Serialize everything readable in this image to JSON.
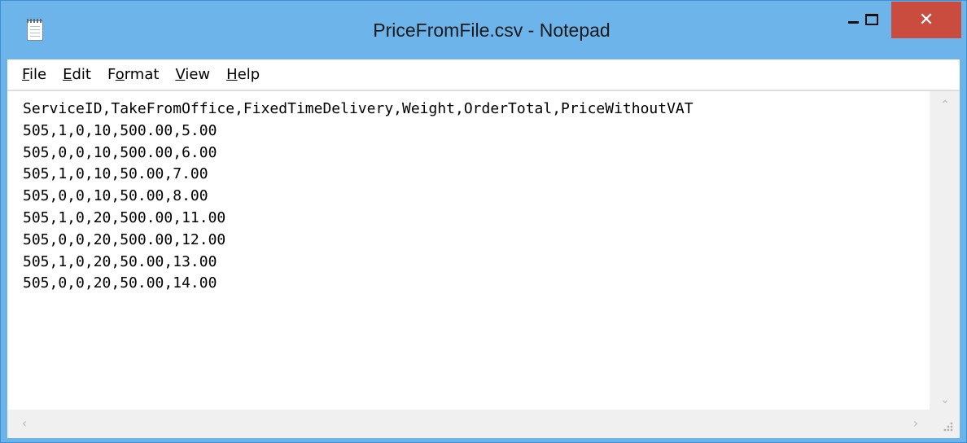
{
  "window": {
    "title": "PriceFromFile.csv - Notepad",
    "icon": "notepad-icon",
    "controls": {
      "minimize_icon": "minimize-icon",
      "maximize_icon": "maximize-icon",
      "close_glyph": "✕"
    },
    "colors": {
      "titlebar": "#6db4ea",
      "close_button": "#c94c3f"
    }
  },
  "menu": {
    "items": [
      {
        "accel": "F",
        "rest": "ile"
      },
      {
        "accel": "E",
        "rest": "dit"
      },
      {
        "pre": "F",
        "accel": "o",
        "rest": "rmat"
      },
      {
        "accel": "V",
        "rest": "iew"
      },
      {
        "accel": "H",
        "rest": "elp"
      }
    ]
  },
  "document": {
    "lines": [
      "ServiceID,TakeFromOffice,FixedTimeDelivery,Weight,OrderTotal,PriceWithoutVAT",
      "505,1,0,10,500.00,5.00",
      "505,0,0,10,500.00,6.00",
      "505,1,0,10,50.00,7.00",
      "505,0,0,10,50.00,8.00",
      "505,1,0,20,500.00,11.00",
      "505,0,0,20,500.00,12.00",
      "505,1,0,20,50.00,13.00",
      "505,0,0,20,50.00,14.00"
    ]
  },
  "scrollbars": {
    "up": "^",
    "down": "v",
    "left": "<",
    "right": ">"
  }
}
